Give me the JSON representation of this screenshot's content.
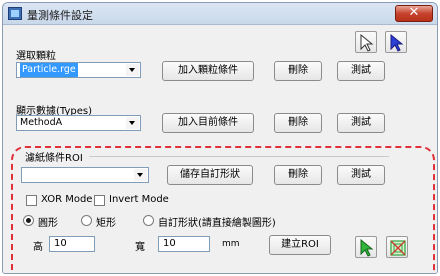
{
  "window": {
    "title": "量測條件設定",
    "close_label": "✕"
  },
  "particle": {
    "label": "選取顆粒",
    "select_value": "Particle.rge",
    "add_button": "加入顆粒條件",
    "delete_button": "刪除",
    "test_button": "測試"
  },
  "display": {
    "label": "顯示數據(Types)",
    "select_value": "MethodA",
    "add_button": "加入目前條件",
    "delete_button": "刪除",
    "test_button": "測試"
  },
  "roi": {
    "label": "濾紙條件ROI",
    "select_value": "",
    "save_button": "儲存自訂形狀",
    "delete_button": "刪除",
    "test_button": "測試",
    "xor_label": "XOR Mode",
    "invert_label": "Invert Mode",
    "shape_options": [
      "圓形",
      "矩形",
      "自訂形狀(請直接繪製圖形)"
    ],
    "selected_shape": "圓形",
    "height_label": "高",
    "height_value": "10",
    "width_label": "寬",
    "width_value": "10",
    "unit": "mm",
    "create_button": "建立ROI"
  },
  "icons": {
    "top_pointer": "pointer-arrow-icon",
    "top_select": "select-arrow-icon",
    "bottom_pointer": "green-pointer-icon",
    "bottom_roi": "roi-target-icon"
  },
  "colors": {
    "highlight": "#3399ff",
    "annotation": "#e0303a",
    "close": "#c7432d"
  }
}
